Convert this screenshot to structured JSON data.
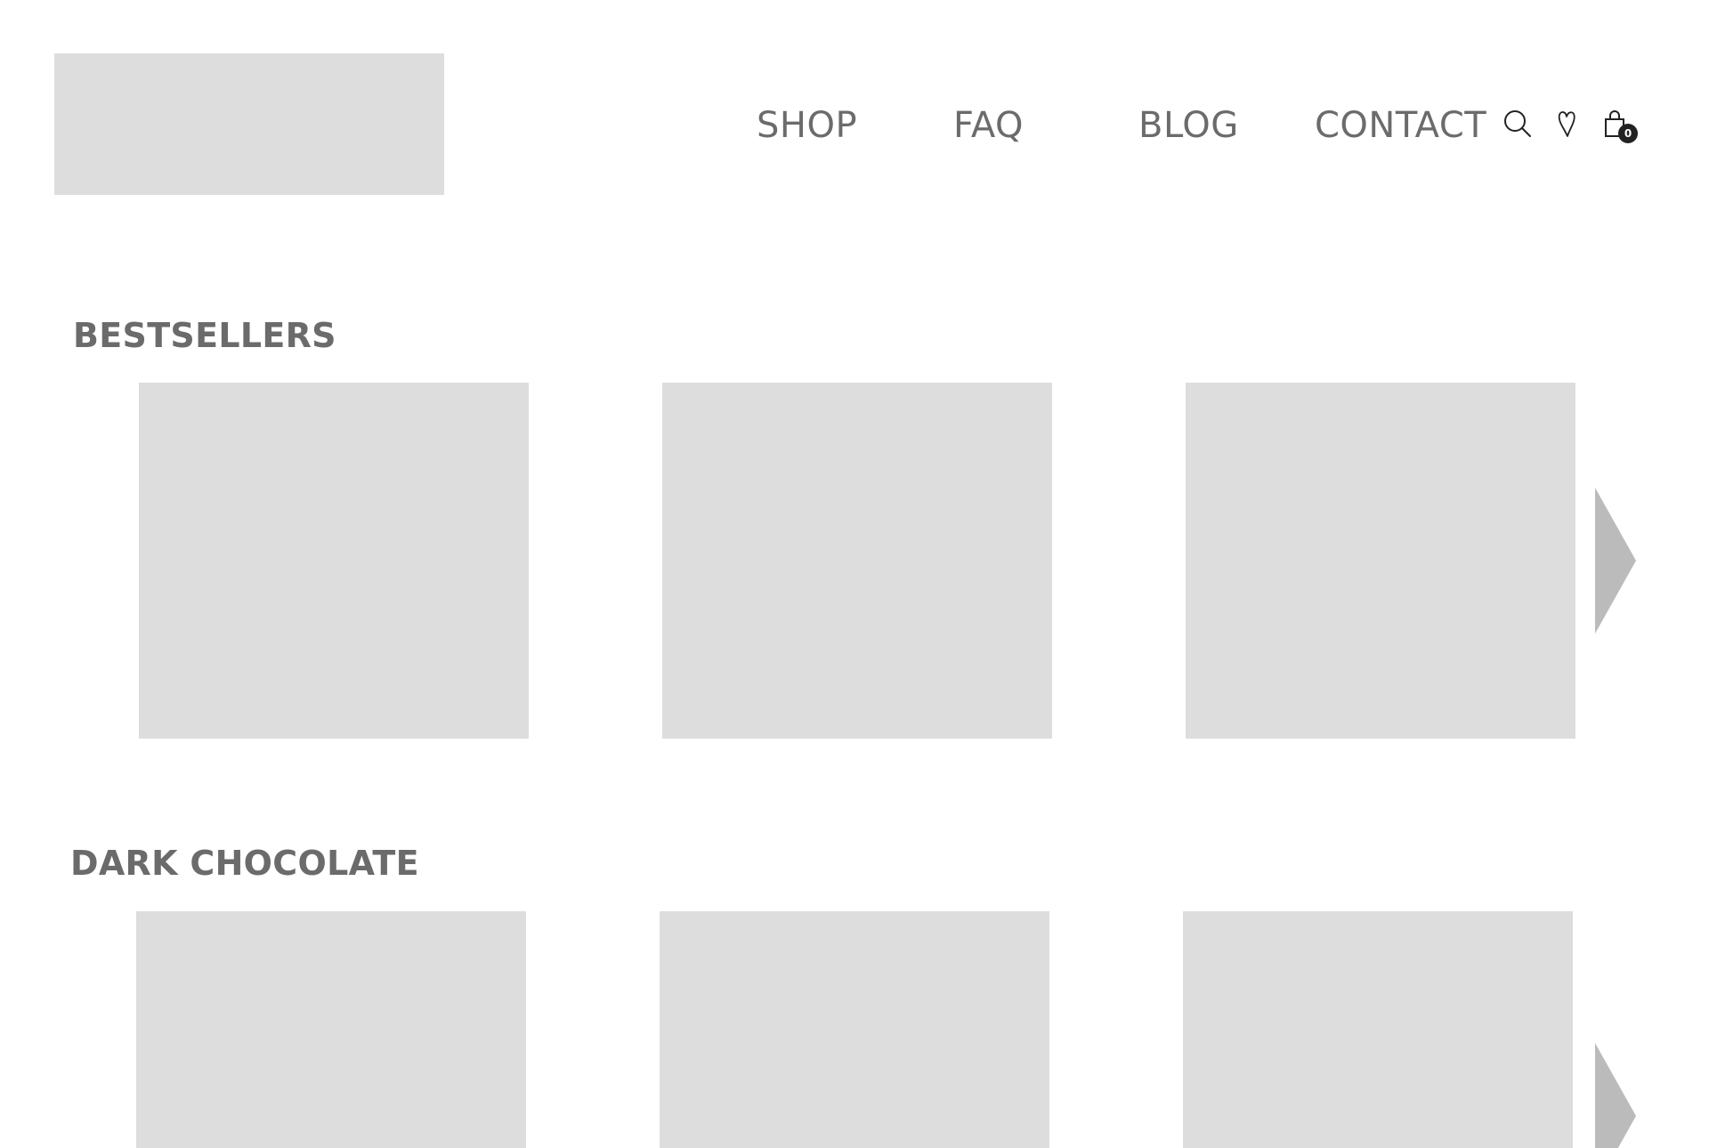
{
  "header": {
    "nav": {
      "shop": "SHOP",
      "faq": "FAQ",
      "blog": "BLOG",
      "contact": "CONTACT"
    },
    "icons": [
      "search-icon",
      "wishlist-heart-icon",
      "shopping-bag-icon"
    ],
    "cart_count": "0"
  },
  "sections": [
    {
      "title": "BESTSELLERS",
      "product_count_visible": 3
    },
    {
      "title": "DARK CHOCOLATE",
      "product_count_visible": 3
    }
  ],
  "colors": {
    "placeholder": "#dddddd",
    "text": "#6b6b6b",
    "arrow": "#bbbbbb",
    "badge": "#222222"
  }
}
